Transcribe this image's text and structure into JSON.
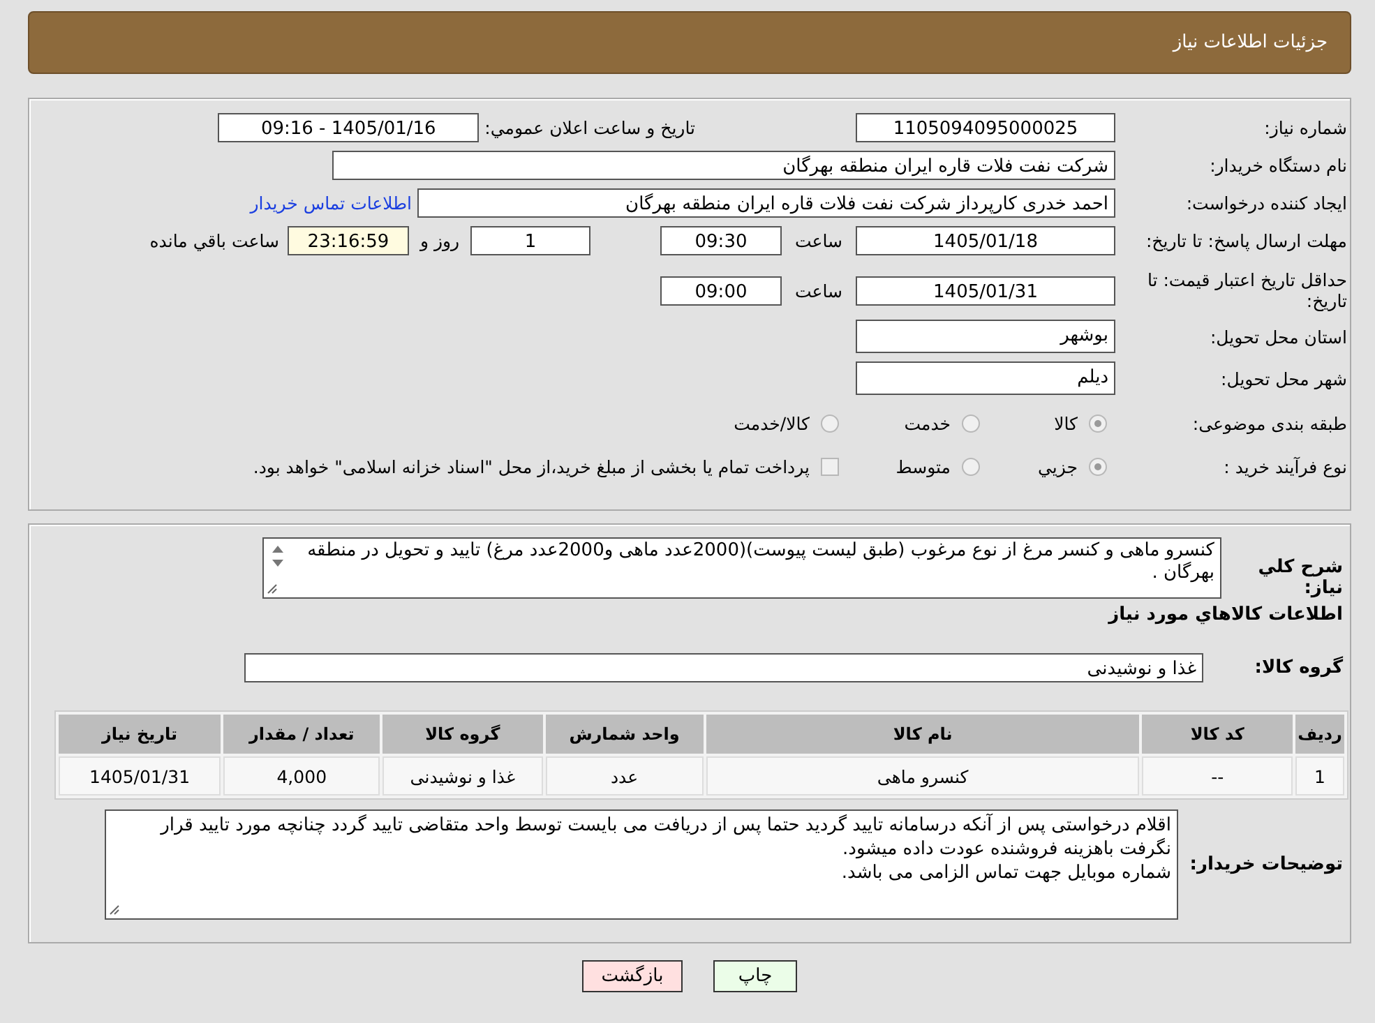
{
  "header": {
    "title": "جزئیات اطلاعات نیاز"
  },
  "details": {
    "need_number": {
      "label": "شماره نیاز:",
      "value": "1105094095000025"
    },
    "announce": {
      "label": "تاریخ و ساعت اعلان عمومي:",
      "value": "1405/01/16 - 09:16"
    },
    "buyer_org": {
      "label": "نام دستگاه خریدار:",
      "value": "شرکت نفت فلات قاره ایران منطقه بهرگان"
    },
    "requester": {
      "label": "ایجاد کننده درخواست:",
      "value": "احمد خدری کارپرداز شرکت نفت فلات قاره ایران منطقه بهرگان",
      "link": "اطلاعات تماس خریدار"
    },
    "response_deadline": {
      "label": "مهلت ارسال پاسخ: تا تاریخ:",
      "date": "1405/01/18",
      "time_label": "ساعت",
      "time": "09:30",
      "days": "1",
      "days_label": "روز و",
      "remaining": "23:16:59",
      "remaining_label": "ساعت باقي مانده"
    },
    "price_validity": {
      "label": "حداقل تاریخ اعتبار قیمت: تا تاریخ:",
      "date": "1405/01/31",
      "time_label": "ساعت",
      "time": "09:00"
    },
    "province": {
      "label": "استان محل تحویل:",
      "value": "بوشهر"
    },
    "city": {
      "label": "شهر محل تحویل:",
      "value": "دیلم"
    },
    "category": {
      "label": "طبقه بندی موضوعی:",
      "options": [
        {
          "label": "کالا",
          "selected": true
        },
        {
          "label": "خدمت",
          "selected": false
        },
        {
          "label": "کالا/خدمت",
          "selected": false
        }
      ]
    },
    "process": {
      "label": "نوع فرآیند خرید :",
      "options": [
        {
          "label": "جزیي",
          "selected": true
        },
        {
          "label": "متوسط",
          "selected": false
        }
      ],
      "payment": {
        "checked": false,
        "text": "پرداخت تمام یا بخشی از مبلغ خرید،از محل \"اسناد خزانه اسلامی\" خواهد بود."
      }
    }
  },
  "summary": {
    "label": "شرح کلي نیاز:",
    "text": "کنسرو ماهی و کنسر مرغ از نوع مرغوب (طبق لیست پیوست)(2000عدد ماهی و2000عدد مرغ) تایید و تحویل در منطقه بهرگان ."
  },
  "items": {
    "heading": "اطلاعات کالاهاي مورد نیاز",
    "group_label": "گروه کالا:",
    "group_value": "غذا و نوشیدنی",
    "table": {
      "columns": [
        "ردیف",
        "کد کالا",
        "نام کالا",
        "واحد شمارش",
        "گروه کالا",
        "تعداد / مقدار",
        "تاریخ نیاز"
      ],
      "rows": [
        [
          "1",
          "--",
          "کنسرو ماهی",
          "عدد",
          "غذا و نوشیدنی",
          "4,000",
          "1405/01/31"
        ]
      ]
    }
  },
  "buyer_notes": {
    "label": "توضیحات خریدار:",
    "lines": [
      "اقلام درخواستی پس از آنکه درسامانه تایید گردید حتما پس از دریافت می بایست توسط واحد متقاضی تایید گردد چنانچه مورد تایید قرار نگرفت باهزینه فروشنده عودت داده میشود.",
      "شماره موبایل جهت تماس الزامی می باشد."
    ]
  },
  "buttons": [
    {
      "kind": "print",
      "label": "چاپ"
    },
    {
      "kind": "back",
      "label": "بازگشت"
    }
  ]
}
